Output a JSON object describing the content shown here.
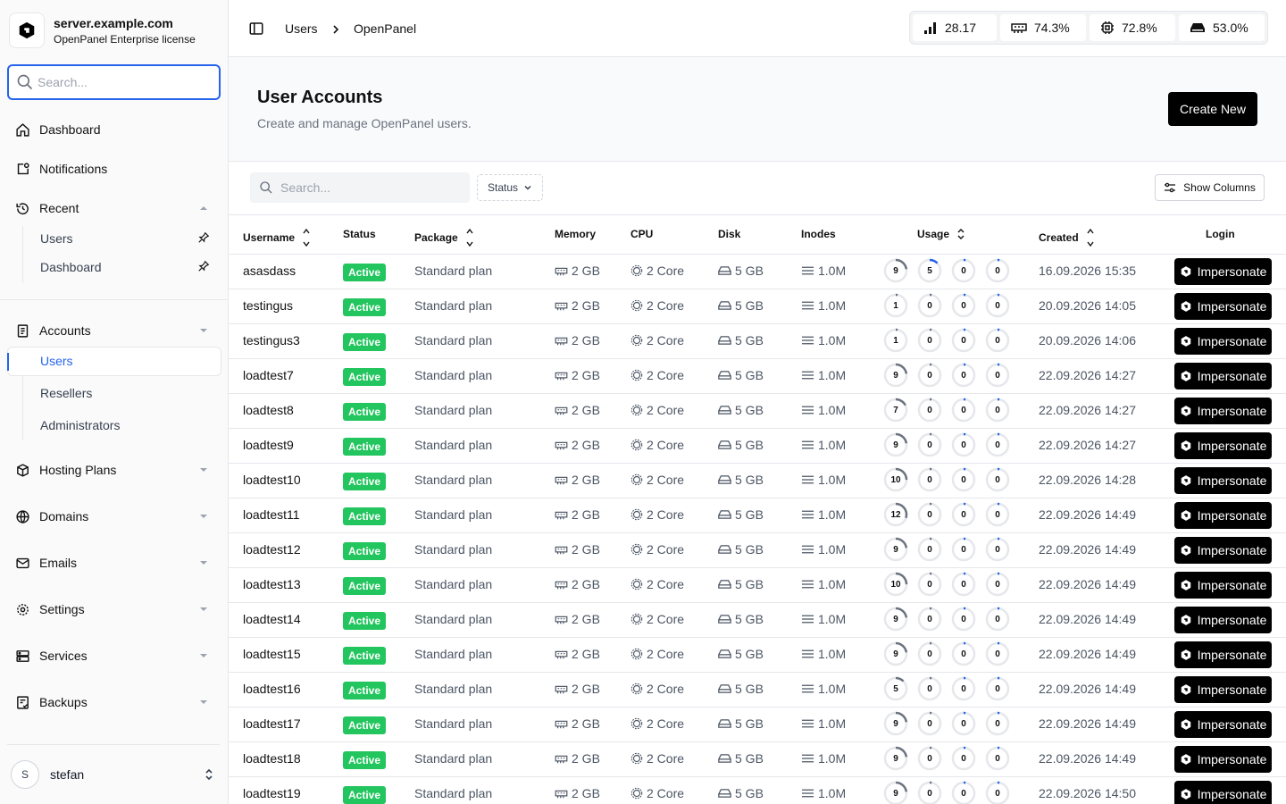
{
  "sidebar": {
    "brand_title": "server.example.com",
    "brand_subtitle": "OpenPanel Enterprise license",
    "search_placeholder": "Search...",
    "items": {
      "dashboard": "Dashboard",
      "notifications": "Notifications",
      "recent": "Recent",
      "recent_users": "Users",
      "recent_dashboard": "Dashboard",
      "accounts": "Accounts",
      "users": "Users",
      "resellers": "Resellers",
      "administrators": "Administrators",
      "hosting_plans": "Hosting Plans",
      "domains": "Domains",
      "emails": "Emails",
      "settings": "Settings",
      "services": "Services",
      "backups": "Backups"
    },
    "user": {
      "initial": "S",
      "name": "stefan"
    }
  },
  "topbar": {
    "breadcrumb": [
      "Users",
      "OpenPanel"
    ],
    "stats": {
      "load": "28.17",
      "ram": "74.3%",
      "cpu": "72.8%",
      "disk": "53.0%"
    }
  },
  "page": {
    "title": "User Accounts",
    "subtitle": "Create and manage OpenPanel users.",
    "create_label": "Create New"
  },
  "filters": {
    "search_placeholder": "Search...",
    "status_label": "Status",
    "columns_label": "Show Columns"
  },
  "table": {
    "headers": {
      "username": "Username",
      "status": "Status",
      "package": "Package",
      "memory": "Memory",
      "cpu": "CPU",
      "disk": "Disk",
      "inodes": "Inodes",
      "usage": "Usage",
      "created": "Created",
      "login": "Login"
    },
    "rows": [
      {
        "username": "asasdass",
        "status": "Active",
        "package": "Standard plan",
        "memory": "2 GB",
        "cpu": "2 Core",
        "disk": "5 GB",
        "inodes": "1.0M",
        "usage": [
          "9",
          "5",
          "0",
          "0"
        ],
        "created": "16.09.2026 15:35",
        "login": "Impersonate"
      },
      {
        "username": "testingus",
        "status": "Active",
        "package": "Standard plan",
        "memory": "2 GB",
        "cpu": "2 Core",
        "disk": "5 GB",
        "inodes": "1.0M",
        "usage": [
          "1",
          "0",
          "0",
          "0"
        ],
        "created": "20.09.2026 14:05",
        "login": "Impersonate"
      },
      {
        "username": "testingus3",
        "status": "Active",
        "package": "Standard plan",
        "memory": "2 GB",
        "cpu": "2 Core",
        "disk": "5 GB",
        "inodes": "1.0M",
        "usage": [
          "1",
          "0",
          "0",
          "0"
        ],
        "created": "20.09.2026 14:06",
        "login": "Impersonate"
      },
      {
        "username": "loadtest7",
        "status": "Active",
        "package": "Standard plan",
        "memory": "2 GB",
        "cpu": "2 Core",
        "disk": "5 GB",
        "inodes": "1.0M",
        "usage": [
          "9",
          "0",
          "0",
          "0"
        ],
        "created": "22.09.2026 14:27",
        "login": "Impersonate"
      },
      {
        "username": "loadtest8",
        "status": "Active",
        "package": "Standard plan",
        "memory": "2 GB",
        "cpu": "2 Core",
        "disk": "5 GB",
        "inodes": "1.0M",
        "usage": [
          "7",
          "0",
          "0",
          "0"
        ],
        "created": "22.09.2026 14:27",
        "login": "Impersonate"
      },
      {
        "username": "loadtest9",
        "status": "Active",
        "package": "Standard plan",
        "memory": "2 GB",
        "cpu": "2 Core",
        "disk": "5 GB",
        "inodes": "1.0M",
        "usage": [
          "9",
          "0",
          "0",
          "0"
        ],
        "created": "22.09.2026 14:27",
        "login": "Impersonate"
      },
      {
        "username": "loadtest10",
        "status": "Active",
        "package": "Standard plan",
        "memory": "2 GB",
        "cpu": "2 Core",
        "disk": "5 GB",
        "inodes": "1.0M",
        "usage": [
          "10",
          "0",
          "0",
          "0"
        ],
        "created": "22.09.2026 14:28",
        "login": "Impersonate"
      },
      {
        "username": "loadtest11",
        "status": "Active",
        "package": "Standard plan",
        "memory": "2 GB",
        "cpu": "2 Core",
        "disk": "5 GB",
        "inodes": "1.0M",
        "usage": [
          "12",
          "0",
          "0",
          "0"
        ],
        "created": "22.09.2026 14:49",
        "login": "Impersonate"
      },
      {
        "username": "loadtest12",
        "status": "Active",
        "package": "Standard plan",
        "memory": "2 GB",
        "cpu": "2 Core",
        "disk": "5 GB",
        "inodes": "1.0M",
        "usage": [
          "9",
          "0",
          "0",
          "0"
        ],
        "created": "22.09.2026 14:49",
        "login": "Impersonate"
      },
      {
        "username": "loadtest13",
        "status": "Active",
        "package": "Standard plan",
        "memory": "2 GB",
        "cpu": "2 Core",
        "disk": "5 GB",
        "inodes": "1.0M",
        "usage": [
          "10",
          "0",
          "0",
          "0"
        ],
        "created": "22.09.2026 14:49",
        "login": "Impersonate"
      },
      {
        "username": "loadtest14",
        "status": "Active",
        "package": "Standard plan",
        "memory": "2 GB",
        "cpu": "2 Core",
        "disk": "5 GB",
        "inodes": "1.0M",
        "usage": [
          "9",
          "0",
          "0",
          "0"
        ],
        "created": "22.09.2026 14:49",
        "login": "Impersonate"
      },
      {
        "username": "loadtest15",
        "status": "Active",
        "package": "Standard plan",
        "memory": "2 GB",
        "cpu": "2 Core",
        "disk": "5 GB",
        "inodes": "1.0M",
        "usage": [
          "9",
          "0",
          "0",
          "0"
        ],
        "created": "22.09.2026 14:49",
        "login": "Impersonate"
      },
      {
        "username": "loadtest16",
        "status": "Active",
        "package": "Standard plan",
        "memory": "2 GB",
        "cpu": "2 Core",
        "disk": "5 GB",
        "inodes": "1.0M",
        "usage": [
          "5",
          "0",
          "0",
          "0"
        ],
        "created": "22.09.2026 14:49",
        "login": "Impersonate"
      },
      {
        "username": "loadtest17",
        "status": "Active",
        "package": "Standard plan",
        "memory": "2 GB",
        "cpu": "2 Core",
        "disk": "5 GB",
        "inodes": "1.0M",
        "usage": [
          "9",
          "0",
          "0",
          "0"
        ],
        "created": "22.09.2026 14:49",
        "login": "Impersonate"
      },
      {
        "username": "loadtest18",
        "status": "Active",
        "package": "Standard plan",
        "memory": "2 GB",
        "cpu": "2 Core",
        "disk": "5 GB",
        "inodes": "1.0M",
        "usage": [
          "9",
          "0",
          "0",
          "0"
        ],
        "created": "22.09.2026 14:49",
        "login": "Impersonate"
      },
      {
        "username": "loadtest19",
        "status": "Active",
        "package": "Standard plan",
        "memory": "2 GB",
        "cpu": "2 Core",
        "disk": "5 GB",
        "inodes": "1.0M",
        "usage": [
          "9",
          "0",
          "0",
          "0"
        ],
        "created": "22.09.2026 14:50",
        "login": "Impersonate"
      }
    ]
  },
  "colors": {
    "accent": "#2563eb",
    "active_badge": "#22c55e",
    "button": "#000000"
  }
}
